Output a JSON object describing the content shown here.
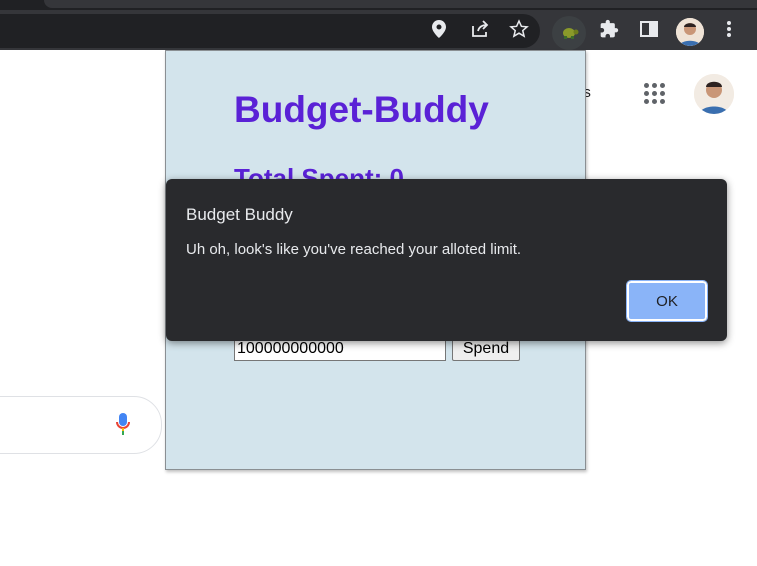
{
  "browser": {
    "icons": [
      "location-pin-icon",
      "share-icon",
      "star-icon",
      "extension-turtle-icon",
      "puzzle-icon",
      "side-panel-icon",
      "avatar",
      "kebab-menu-icon"
    ]
  },
  "google": {
    "apps_label_partial": "es",
    "search_placeholder": ""
  },
  "popup": {
    "title": "Budget-Buddy",
    "total_spent": "Total Spent: 0",
    "amount_value": "100000000000",
    "spend_label": "Spend"
  },
  "alert": {
    "title": "Budget Buddy",
    "message": "Uh oh, look's like you've reached your alloted limit.",
    "ok_label": "OK"
  },
  "colors": {
    "accent": "#5a21d6",
    "popup_bg": "#d3e4ec",
    "alert_bg": "#292a2d",
    "ok_button": "#8ab4f8"
  }
}
